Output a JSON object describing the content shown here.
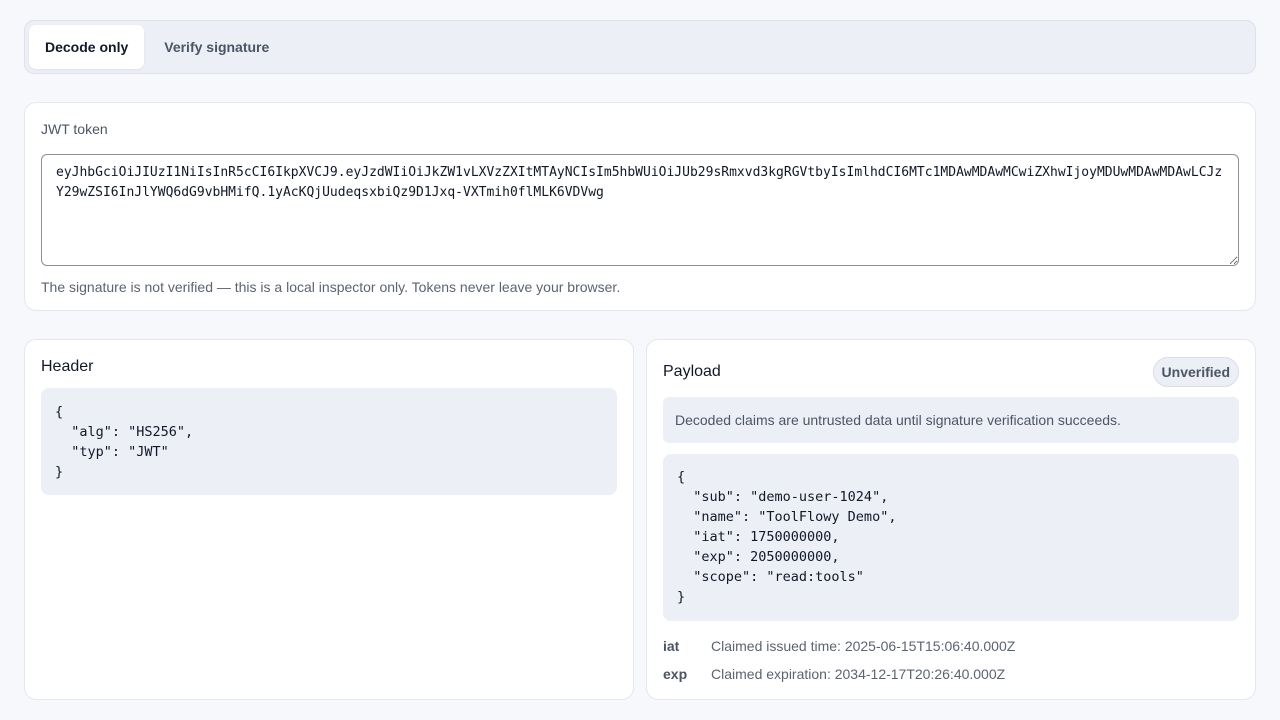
{
  "tabs": [
    {
      "label": "Decode only",
      "active": true
    },
    {
      "label": "Verify signature",
      "active": false
    }
  ],
  "token": {
    "label": "JWT token",
    "value": "eyJhbGciOiJIUzI1NiIsInR5cCI6IkpXVCJ9.eyJzdWIiOiJkZW1vLXVzZXItMTAyNCIsIm5hbWUiOiJUb29sRmxvd3kgRGVtbyIsImlhdCI6MTc1MDAwMDAwMCwiZXhwIjoyMDUwMDAwMDAwLCJzY29wZSI6InJlYWQ6dG9vbHMifQ.1yAcKQjUudeqsxbiQz9D1Jxq-VXTmih0flMLK6VDVwg",
    "hint": "The signature is not verified — this is a local inspector only. Tokens never leave your browser."
  },
  "header": {
    "title": "Header",
    "json": "{\n  \"alg\": \"HS256\",\n  \"typ\": \"JWT\"\n}"
  },
  "payload": {
    "title": "Payload",
    "badge": "Unverified",
    "notice": "Decoded claims are untrusted data until signature verification succeeds.",
    "json": "{\n  \"sub\": \"demo-user-1024\",\n  \"name\": \"ToolFlowy Demo\",\n  \"iat\": 1750000000,\n  \"exp\": 2050000000,\n  \"scope\": \"read:tools\"\n}",
    "claims": [
      {
        "key": "iat",
        "value": "Claimed issued time: 2025-06-15T15:06:40.000Z"
      },
      {
        "key": "exp",
        "value": "Claimed expiration: 2034-12-17T20:26:40.000Z"
      }
    ]
  },
  "colors": {
    "background": "#f6f8fb",
    "panel": "#eceff6",
    "text": "#111827",
    "muted": "#4b5565"
  }
}
